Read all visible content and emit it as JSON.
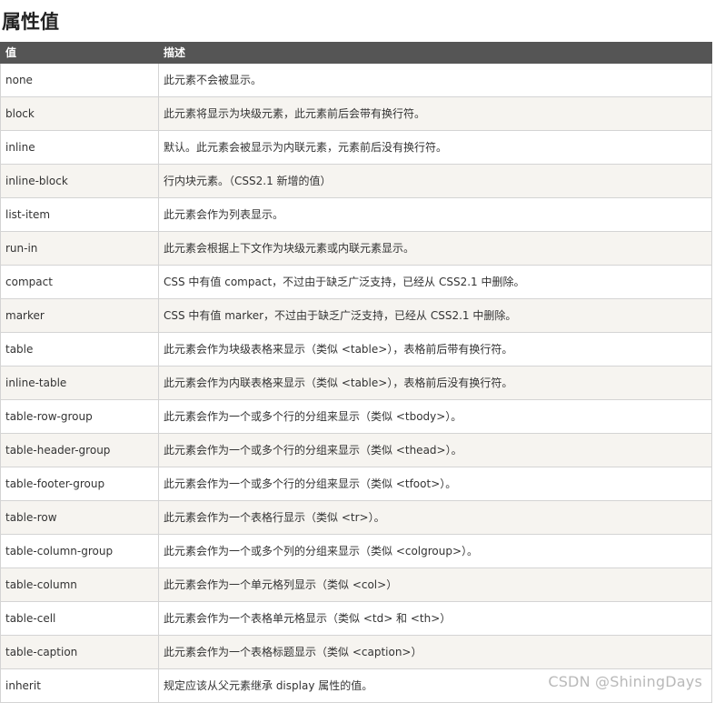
{
  "title": "属性值",
  "table": {
    "headers": [
      "值",
      "描述"
    ],
    "rows": [
      {
        "value": "none",
        "desc": "此元素不会被显示。"
      },
      {
        "value": "block",
        "desc": "此元素将显示为块级元素，此元素前后会带有换行符。"
      },
      {
        "value": "inline",
        "desc": "默认。此元素会被显示为内联元素，元素前后没有换行符。"
      },
      {
        "value": "inline-block",
        "desc": "行内块元素。（CSS2.1 新增的值）"
      },
      {
        "value": "list-item",
        "desc": "此元素会作为列表显示。"
      },
      {
        "value": "run-in",
        "desc": "此元素会根据上下文作为块级元素或内联元素显示。"
      },
      {
        "value": "compact",
        "desc": "CSS 中有值 compact，不过由于缺乏广泛支持，已经从 CSS2.1 中删除。"
      },
      {
        "value": "marker",
        "desc": "CSS 中有值 marker，不过由于缺乏广泛支持，已经从 CSS2.1 中删除。"
      },
      {
        "value": "table",
        "desc": "此元素会作为块级表格来显示（类似 <table>），表格前后带有换行符。"
      },
      {
        "value": "inline-table",
        "desc": "此元素会作为内联表格来显示（类似 <table>），表格前后没有换行符。"
      },
      {
        "value": "table-row-group",
        "desc": "此元素会作为一个或多个行的分组来显示（类似 <tbody>）。"
      },
      {
        "value": "table-header-group",
        "desc": "此元素会作为一个或多个行的分组来显示（类似 <thead>）。"
      },
      {
        "value": "table-footer-group",
        "desc": "此元素会作为一个或多个行的分组来显示（类似 <tfoot>）。"
      },
      {
        "value": "table-row",
        "desc": "此元素会作为一个表格行显示（类似 <tr>）。"
      },
      {
        "value": "table-column-group",
        "desc": "此元素会作为一个或多个列的分组来显示（类似 <colgroup>）。"
      },
      {
        "value": "table-column",
        "desc": "此元素会作为一个单元格列显示（类似 <col>）"
      },
      {
        "value": "table-cell",
        "desc": "此元素会作为一个表格单元格显示（类似 <td> 和 <th>）"
      },
      {
        "value": "table-caption",
        "desc": "此元素会作为一个表格标题显示（类似 <caption>）"
      },
      {
        "value": "inherit",
        "desc": "规定应该从父元素继承 display 属性的值。"
      }
    ]
  },
  "watermark": "CSDN @ShiningDays",
  "colors": {
    "header_bg": "#555555",
    "row_alt_bg": "#f6f4f0",
    "border": "#d4d4d4"
  }
}
